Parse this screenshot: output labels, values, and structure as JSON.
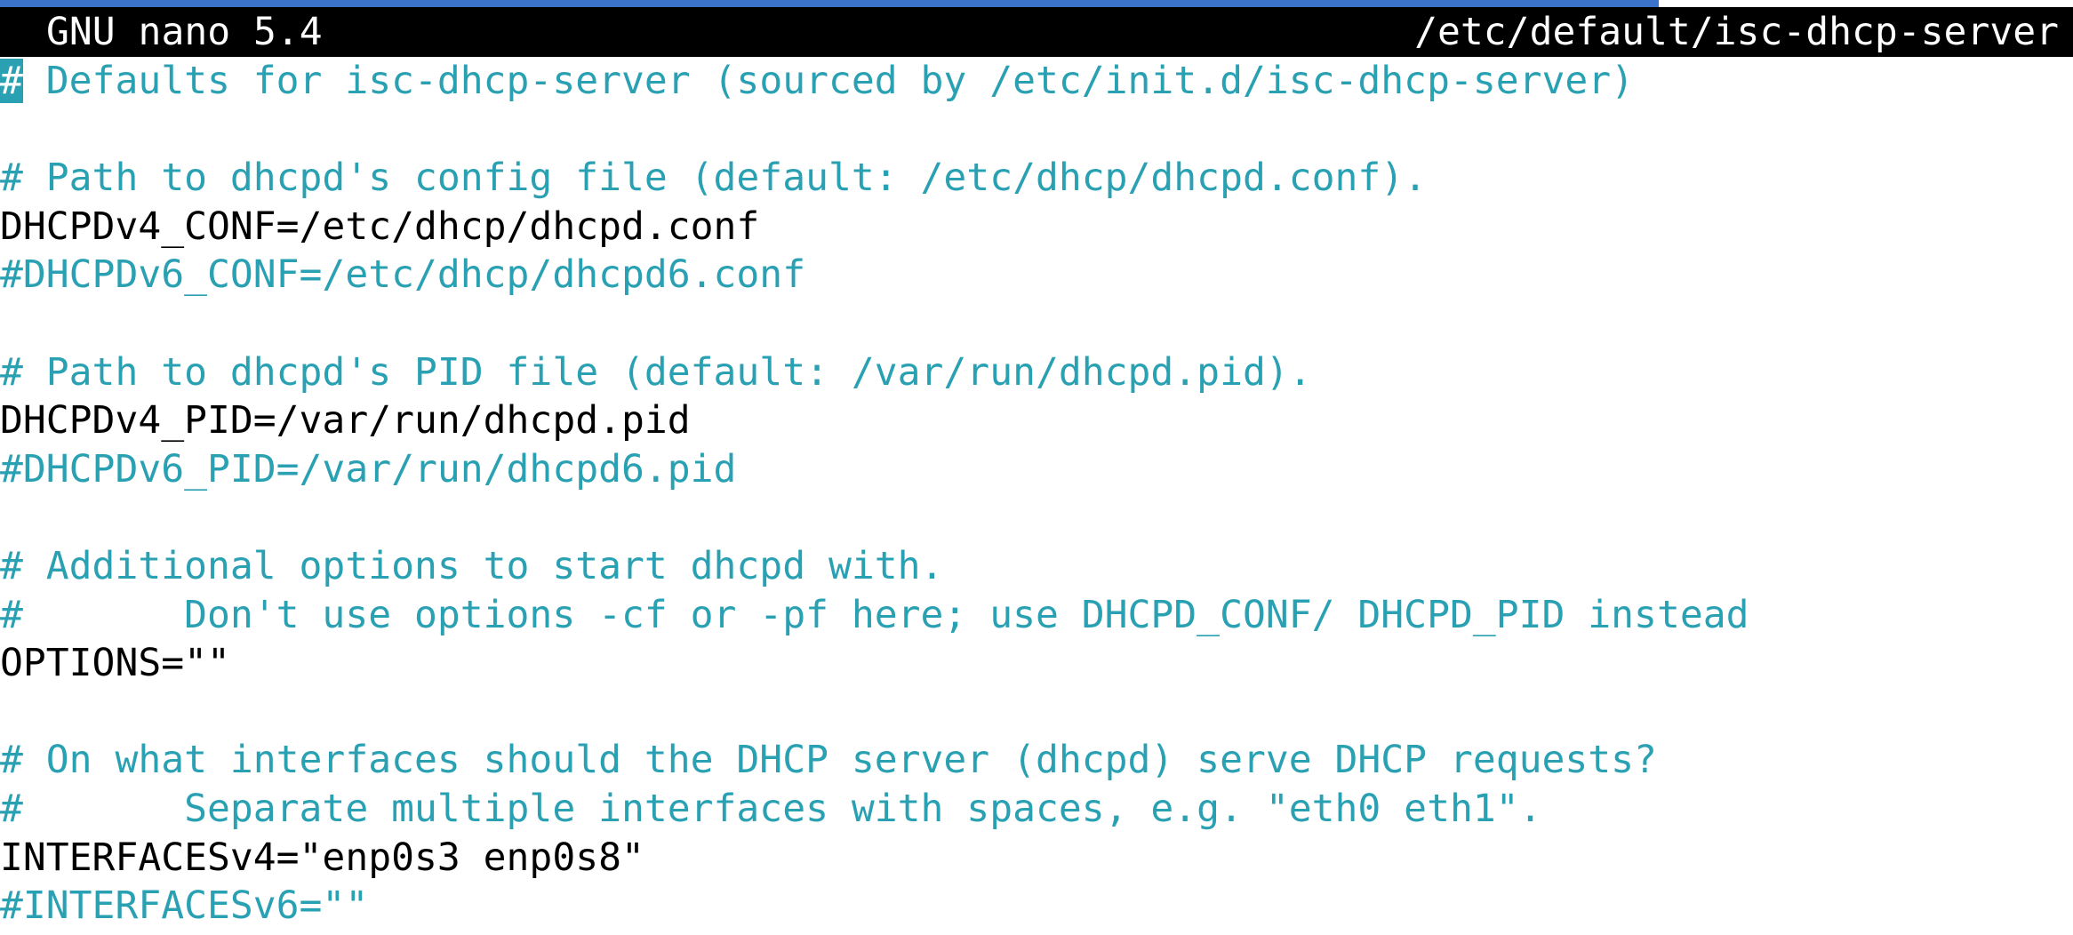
{
  "app": {
    "name": "GNU nano 5.4",
    "file_path": "/etc/default/isc-dhcp-server"
  },
  "colors": {
    "title_bar_bg": "#000000",
    "title_bar_fg": "#ffffff",
    "comment": "#2aa1b3",
    "text": "#000000",
    "accent_bar": "#3a73c9"
  },
  "editor": {
    "cursor_char": "#",
    "lines": [
      {
        "text": " Defaults for isc-dhcp-server (sourced by /etc/init.d/isc-dhcp-server)"
      },
      {
        "text": ""
      },
      {
        "text": "# Path to dhcpd's config file (default: /etc/dhcp/dhcpd.conf)."
      },
      {
        "text": "DHCPDv4_CONF=/etc/dhcp/dhcpd.conf"
      },
      {
        "text": "#DHCPDv6_CONF=/etc/dhcp/dhcpd6.conf"
      },
      {
        "text": ""
      },
      {
        "text": "# Path to dhcpd's PID file (default: /var/run/dhcpd.pid)."
      },
      {
        "text": "DHCPDv4_PID=/var/run/dhcpd.pid"
      },
      {
        "text": "#DHCPDv6_PID=/var/run/dhcpd6.pid"
      },
      {
        "text": ""
      },
      {
        "text": "# Additional options to start dhcpd with."
      },
      {
        "text": "#       Don't use options -cf or -pf here; use DHCPD_CONF/ DHCPD_PID instead"
      },
      {
        "text": "OPTIONS=\"\""
      },
      {
        "text": ""
      },
      {
        "text": "# On what interfaces should the DHCP server (dhcpd) serve DHCP requests?"
      },
      {
        "text": "#       Separate multiple interfaces with spaces, e.g. \"eth0 eth1\"."
      },
      {
        "text": "INTERFACESv4=\"enp0s3 enp0s8\""
      },
      {
        "text": "#INTERFACESv6=\"\""
      }
    ]
  }
}
